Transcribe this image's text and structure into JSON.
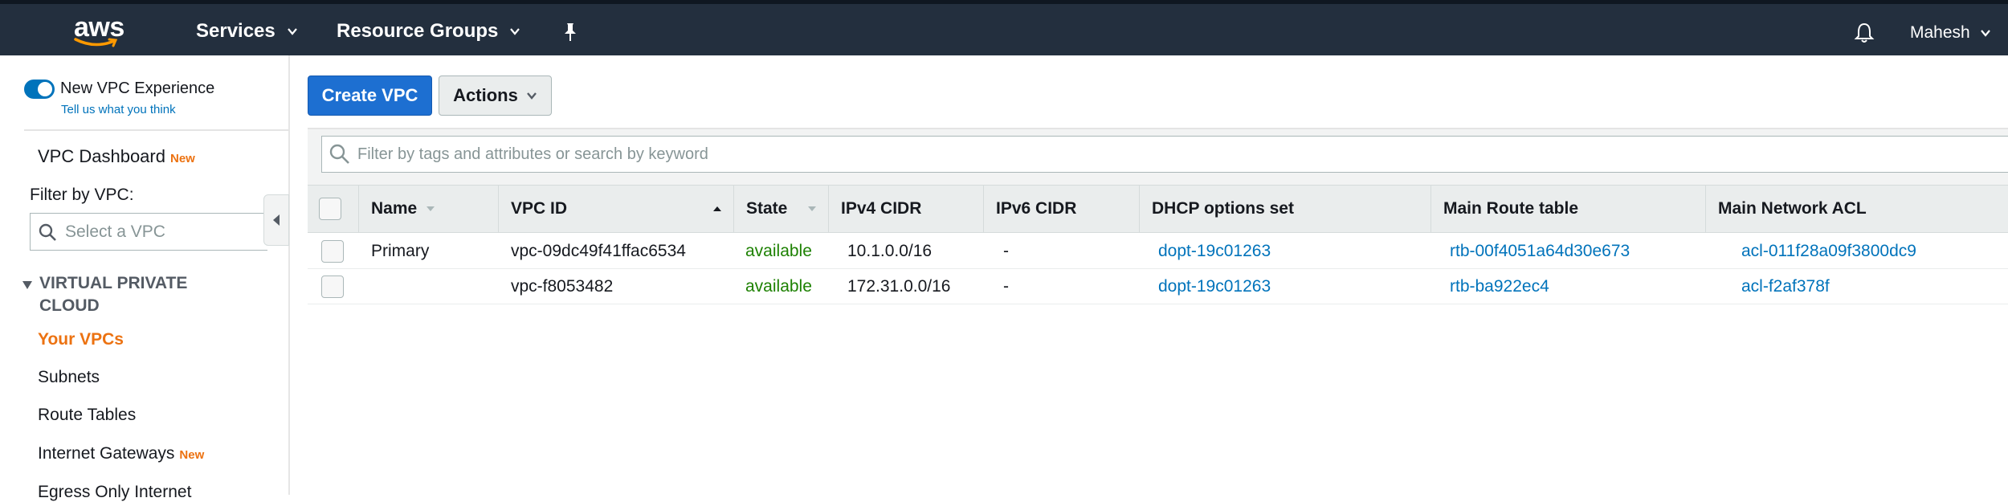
{
  "topnav": {
    "logo_text": "aws",
    "services": "Services",
    "resource_groups": "Resource Groups",
    "user": "Mahesh"
  },
  "sidebar": {
    "new_vpc_experience": "New VPC Experience",
    "new_vpc_experience_enabled": true,
    "tell_us": "Tell us what you think",
    "dashboard": "VPC Dashboard",
    "new_badge": "New",
    "filter_label": "Filter by VPC:",
    "select_placeholder": "Select a VPC",
    "section_heading_line1": "VIRTUAL PRIVATE",
    "section_heading_line2": "CLOUD",
    "items": [
      {
        "label": "Your VPCs",
        "active": true
      },
      {
        "label": "Subnets",
        "active": false
      },
      {
        "label": "Route Tables",
        "active": false
      },
      {
        "label": "Internet Gateways",
        "badge": "New",
        "active": false
      },
      {
        "label": "Egress Only Internet",
        "active": false
      }
    ]
  },
  "toolbar": {
    "create_label": "Create VPC",
    "actions_label": "Actions"
  },
  "search": {
    "placeholder": "Filter by tags and attributes or search by keyword"
  },
  "table": {
    "headers": {
      "name": "Name",
      "vpc_id": "VPC ID",
      "state": "State",
      "ipv4": "IPv4 CIDR",
      "ipv6": "IPv6 CIDR",
      "dhcp": "DHCP options set",
      "route": "Main Route table",
      "acl": "Main Network ACL"
    },
    "rows": [
      {
        "name": "Primary",
        "vpc_id": "vpc-09dc49f41ffac6534",
        "state": "available",
        "ipv4": "10.1.0.0/16",
        "ipv6": "-",
        "dhcp": "dopt-19c01263",
        "route": "rtb-00f4051a64d30e673",
        "acl": "acl-011f28a09f3800dc9"
      },
      {
        "name": "",
        "vpc_id": "vpc-f8053482",
        "state": "available",
        "ipv4": "172.31.0.0/16",
        "ipv6": "-",
        "dhcp": "dopt-19c01263",
        "route": "rtb-ba922ec4",
        "acl": "acl-f2af378f"
      }
    ]
  },
  "colors": {
    "nav_bg": "#232f3e",
    "primary_button": "#1d6fd1",
    "link": "#0073bb",
    "active_nav": "#ec7211",
    "state_available": "#1d8102"
  }
}
